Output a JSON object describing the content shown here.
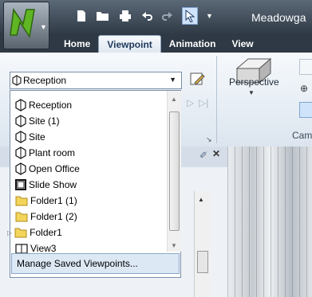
{
  "app": {
    "title": "Meadowga"
  },
  "tabs": [
    "Home",
    "Viewpoint",
    "Animation",
    "View"
  ],
  "ribbon": {
    "perspective_label": "Perspective",
    "camera_group_label": "Cam",
    "viewpoint_selected": "Reception"
  },
  "popup": {
    "items": [
      {
        "label": "Reception",
        "icon": "camera-icon"
      },
      {
        "label": "Site (1)",
        "icon": "camera-icon"
      },
      {
        "label": "Site",
        "icon": "camera-icon"
      },
      {
        "label": "Plant room",
        "icon": "camera-icon"
      },
      {
        "label": "Open Office",
        "icon": "camera-icon"
      },
      {
        "label": "Slide Show",
        "icon": "animation-icon"
      },
      {
        "label": "Folder1 (1)",
        "icon": "folder-icon"
      },
      {
        "label": "Folder1 (2)",
        "icon": "folder-icon"
      },
      {
        "label": "Folder1",
        "icon": "folder-icon"
      },
      {
        "label": "View3",
        "icon": "camera-orthographic-icon"
      }
    ],
    "manage_label": "Manage Saved Viewpoints..."
  }
}
